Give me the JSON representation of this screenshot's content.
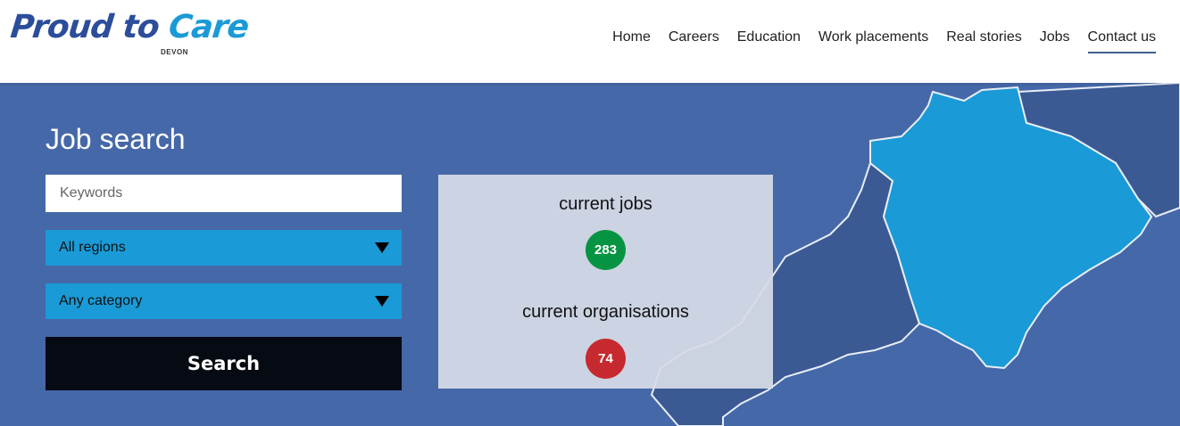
{
  "header": {
    "logo": {
      "text_main": "Proud to ",
      "text_accent": "Care",
      "sub": "DEVON"
    },
    "nav": [
      {
        "label": "Home",
        "active": false
      },
      {
        "label": "Careers",
        "active": false
      },
      {
        "label": "Education",
        "active": false
      },
      {
        "label": "Work placements",
        "active": false
      },
      {
        "label": "Real stories",
        "active": false
      },
      {
        "label": "Jobs",
        "active": false
      },
      {
        "label": "Contact us",
        "active": true
      }
    ]
  },
  "search": {
    "title": "Job search",
    "keywords_placeholder": "Keywords",
    "region_selected": "All regions",
    "category_selected": "Any category",
    "button_label": "Search"
  },
  "stats": {
    "jobs_label": "current jobs",
    "jobs_count": "283",
    "orgs_label": "current organisations",
    "orgs_count": "74"
  },
  "colors": {
    "hero_bg": "#4568a8",
    "accent_blue": "#1a9ad6",
    "jobs_badge": "#079442",
    "orgs_badge": "#c62a2f",
    "search_button": "#060a12"
  }
}
